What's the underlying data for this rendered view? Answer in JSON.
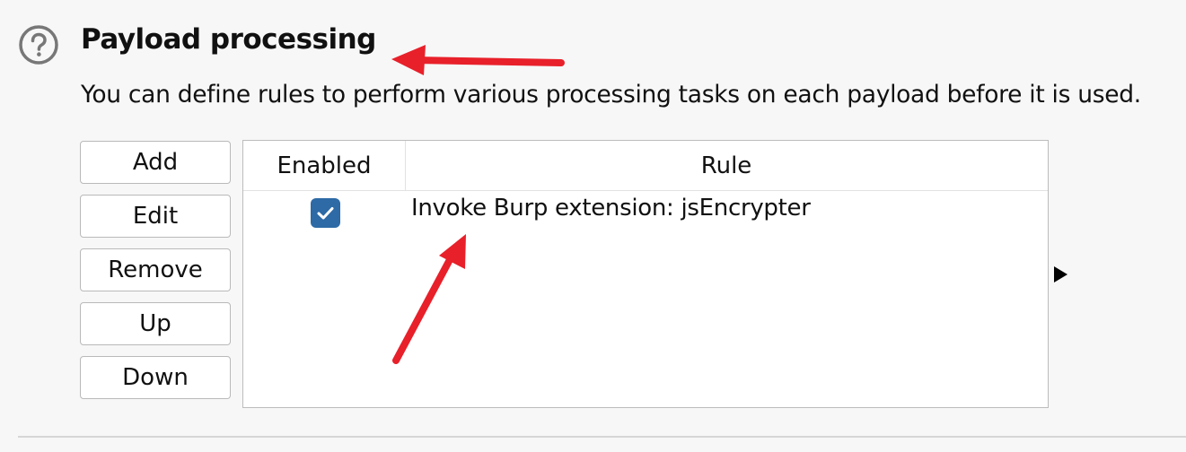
{
  "section": {
    "help_icon": "question-circle-icon",
    "title": "Payload processing",
    "description": "You can define rules to perform various processing tasks on each payload before it is used."
  },
  "buttons": {
    "add": "Add",
    "edit": "Edit",
    "remove": "Remove",
    "up": "Up",
    "down": "Down"
  },
  "table": {
    "columns": [
      "Enabled",
      "Rule"
    ],
    "rows": [
      {
        "enabled": true,
        "rule": "Invoke Burp extension: jsEncrypter"
      }
    ]
  },
  "colors": {
    "checkbox": "#2d6aa6",
    "annotation_arrow": "#e8202a"
  }
}
